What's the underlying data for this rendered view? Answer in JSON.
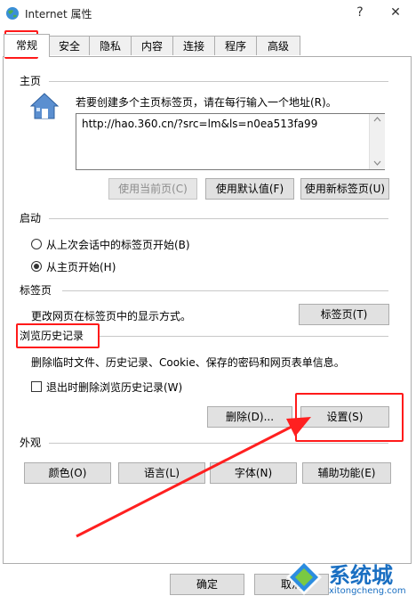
{
  "window": {
    "title": "Internet 属性",
    "help_label": "?",
    "close_label": "✕"
  },
  "tabs": [
    {
      "label": "常规",
      "active": true
    },
    {
      "label": "安全"
    },
    {
      "label": "隐私"
    },
    {
      "label": "内容"
    },
    {
      "label": "连接"
    },
    {
      "label": "程序"
    },
    {
      "label": "高级"
    }
  ],
  "homepage": {
    "section_label": "主页",
    "instruction": "若要创建多个主页标签页，请在每行输入一个地址(R)。",
    "url_value": "http://hao.360.cn/?src=lm&ls=n0ea513fa99",
    "use_current_label": "使用当前页(C)",
    "use_default_label": "使用默认值(F)",
    "use_new_tab_label": "使用新标签页(U)"
  },
  "startup": {
    "section_label": "启动",
    "option_last_session": "从上次会话中的标签页开始(B)",
    "option_homepage": "从主页开始(H)"
  },
  "tabs_section": {
    "section_label": "标签页",
    "description": "更改网页在标签页中的显示方式。",
    "button_label": "标签页(T)"
  },
  "history": {
    "section_label": "浏览历史记录",
    "description": "删除临时文件、历史记录、Cookie、保存的密码和网页表单信息。",
    "delete_on_exit_label": "退出时删除浏览历史记录(W)",
    "delete_button_label": "删除(D)...",
    "settings_button_label": "设置(S)"
  },
  "appearance": {
    "section_label": "外观",
    "colors_label": "颜色(O)",
    "languages_label": "语言(L)",
    "fonts_label": "字体(N)",
    "accessibility_label": "辅助功能(E)"
  },
  "footer": {
    "ok_label": "确定",
    "cancel_label": "取消"
  },
  "watermark": {
    "brand": "系统城",
    "domain": "xitongcheng.com"
  },
  "colors": {
    "highlight_red": "#ff1a1a",
    "arrow_red": "#ff2020"
  }
}
